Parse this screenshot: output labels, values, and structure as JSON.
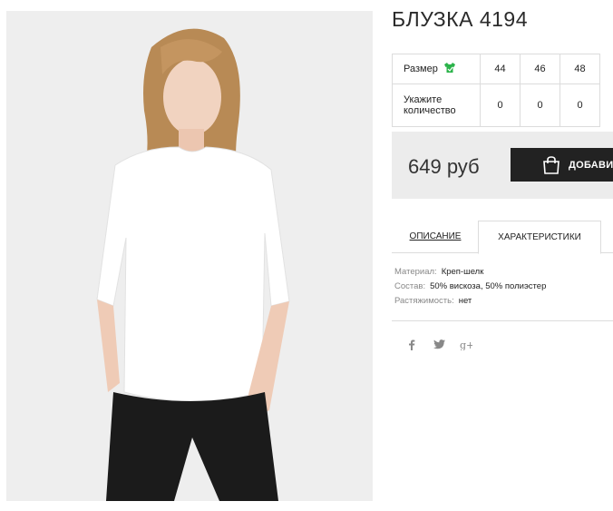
{
  "product": {
    "title": "БЛУЗКА 4194",
    "image_alt": "Woman in white blouse and black pants"
  },
  "sizes": {
    "size_label": "Размер",
    "qty_label": "Укажите количество",
    "values": [
      "44",
      "46",
      "48"
    ],
    "quantities": [
      "0",
      "0",
      "0"
    ]
  },
  "purchase": {
    "price": "649 руб",
    "add_button": "ДОБАВИТЬ"
  },
  "tabs": [
    {
      "label": "ОПИСАНИЕ",
      "active": false
    },
    {
      "label": "ХАРАКТЕРИСТИКИ",
      "active": true
    }
  ],
  "characteristics": [
    {
      "key": "Материал:",
      "value": "Креп-шелк"
    },
    {
      "key": "Состав:",
      "value": "50% вискоза, 50% полиэстер"
    },
    {
      "key": "Растяжимость:",
      "value": "нет"
    }
  ],
  "social": [
    "facebook-icon",
    "twitter-icon",
    "google-plus-icon"
  ],
  "colors": {
    "accent_green": "#2bb34a",
    "button_dark": "#222222",
    "price_bg": "#ececec"
  }
}
